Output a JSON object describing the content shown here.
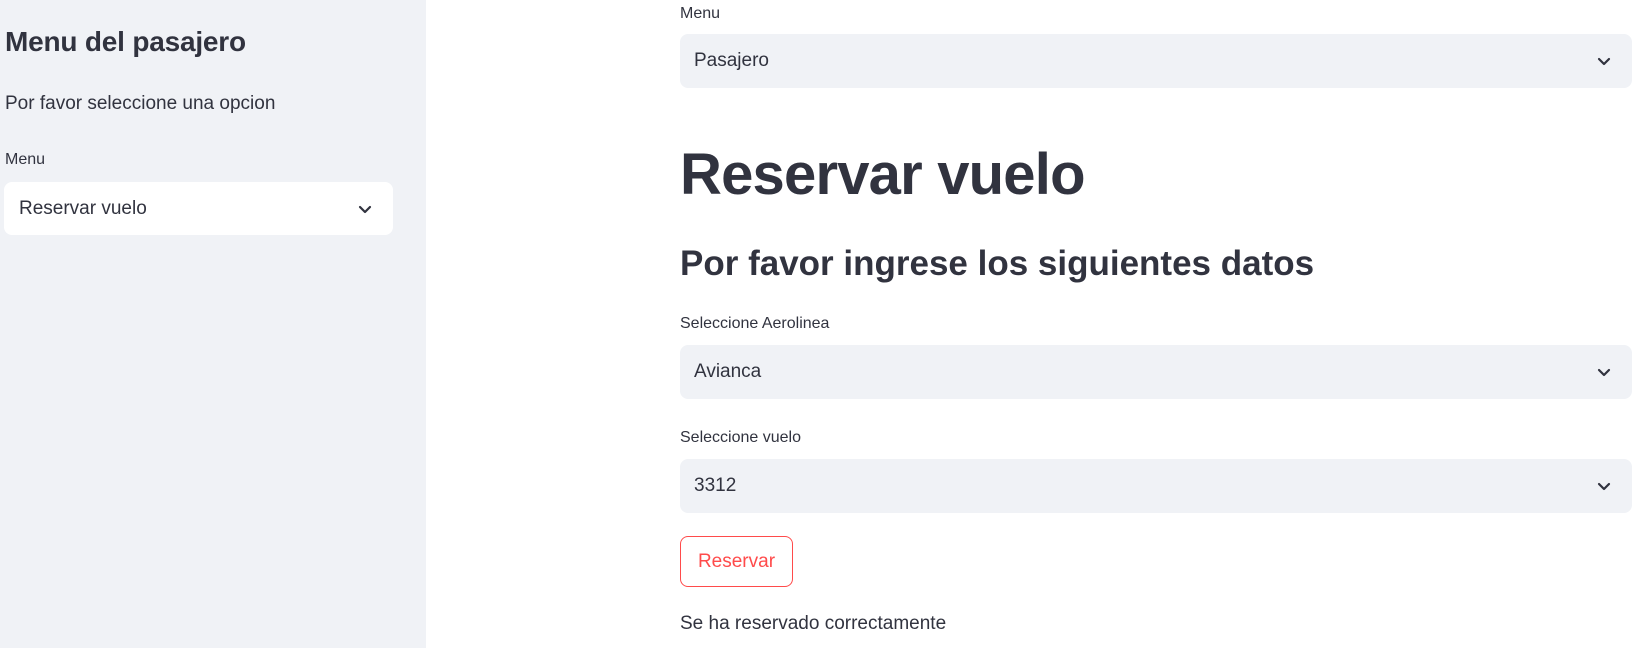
{
  "sidebar": {
    "title": "Menu del pasajero",
    "prompt": "Por favor seleccione una opcion",
    "menu_label": "Menu",
    "menu_value": "Reservar vuelo"
  },
  "main": {
    "menu_label": "Menu",
    "menu_value": "Pasajero",
    "title": "Reservar vuelo",
    "subtitle": "Por favor ingrese los siguientes datos",
    "airline_label": "Seleccione Aerolinea",
    "airline_value": "Avianca",
    "flight_label": "Seleccione vuelo",
    "flight_value": "3312",
    "reserve_button_label": "Reservar",
    "status_message": "Se ha reservado correctamente"
  },
  "icons": {
    "chevron": "chevron-down-icon"
  },
  "colors": {
    "sidebar_background": "#f0f2f6",
    "select_background": "#f0f2f6",
    "text": "#31333f",
    "accent": "#ff4b4b"
  }
}
